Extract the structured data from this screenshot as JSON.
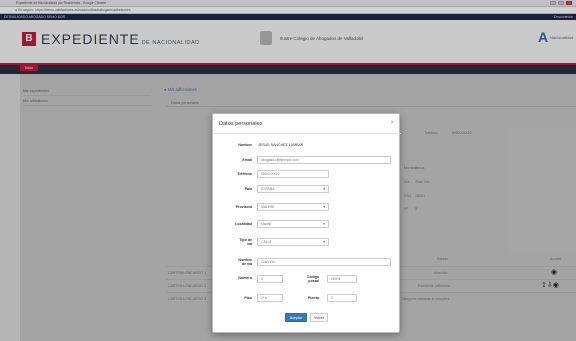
{
  "browser": {
    "window_title": "Expediente de Nacionalidad por Residencia - Google Chrome",
    "secure_label": "Es seguro",
    "url": "https://demo.validaciones.es/nacionalidad/abogado/adhesiones"
  },
  "banner": {
    "user": "DESVALIDADO ABOGADO DEMO DOS",
    "logout": "Desconectar"
  },
  "header": {
    "logo_letter": "B",
    "logo_main": "EXPEDIENTE",
    "logo_sub": "DE NACIONALIDAD",
    "college": "Ilustre Colegio de Abogados de Valladolid",
    "right_logo_letter": "A",
    "right_logo_text": "Nacionalidad"
  },
  "nav": {
    "active": "Inicio"
  },
  "sidebar": {
    "items": [
      "Mis expedientes",
      "Mis adhesiones"
    ]
  },
  "main": {
    "title": "Mis adhesiones",
    "panel_head": "Datos personales",
    "info": [
      {
        "label": "Teléfono",
        "value": "600XXXX22"
      },
      {
        "label": "Nombre",
        "value": "Jesús"
      },
      {
        "label": "Vía",
        "value": "Gran Vía"
      },
      {
        "label": "Cód.",
        "value": "28001"
      },
      {
        "label": "Nº",
        "value": "3"
      }
    ],
    "table_head": [
      "Estado",
      "Acción"
    ],
    "rows": [
      {
        "name": "CARTERA ENCARGO 1",
        "status": "Admitido"
      },
      {
        "name": "CARTERA ENCARGO 2",
        "status": "Pendiente validación"
      },
      {
        "name": "CARTERA ENCARGO 3",
        "status": "Categoría validada al completo"
      }
    ]
  },
  "modal": {
    "title": "Datos personales",
    "close_icon": "×",
    "fields": {
      "nombre_label": "Nombre",
      "nombre_value": "JESUS SANCHEZ LAMBAR",
      "email_label": "Email",
      "email_value": "abogado1@ejemplo.com",
      "telefono_label": "Teléfono",
      "telefono_value": "600XXXX22",
      "pais_label": "País",
      "pais_value": "ESPAÑA",
      "provincia_label": "Provincia",
      "provincia_value": "MADRID",
      "localidad_label": "Localidad",
      "localidad_value": "Madrid",
      "tipo_via_label_1": "Tipo de",
      "tipo_via_label_2": "vía",
      "tipo_via_value": "CALLE",
      "nombre_via_label_1": "Nombre",
      "nombre_via_label_2": "de vía",
      "nombre_via_value": "Gran Vía",
      "numero_label": "Número",
      "numero_value": "3",
      "cp_label_1": "Código",
      "cp_label_2": "postal",
      "cp_value": "28001",
      "piso_label": "Piso",
      "piso_value": "2º A",
      "puerta_label": "Puerta",
      "puerta_value": "C"
    },
    "ok": "Aceptar",
    "cancel": "Volver"
  }
}
